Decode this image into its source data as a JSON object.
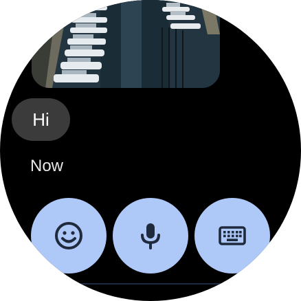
{
  "messages": [
    {
      "type": "image",
      "image_description_icon": "marina-photo"
    },
    {
      "type": "text",
      "text": "Hi"
    }
  ],
  "timestamp": "Now",
  "actions": [
    {
      "name": "emoji",
      "icon": "emoji-icon"
    },
    {
      "name": "voice",
      "icon": "mic-icon"
    },
    {
      "name": "keyboard",
      "icon": "keyboard-icon"
    }
  ],
  "colors": {
    "background": "#000000",
    "bubble": "#3b3b3b",
    "action_button": "#aec8f7",
    "icon": "#1f2a3d"
  }
}
